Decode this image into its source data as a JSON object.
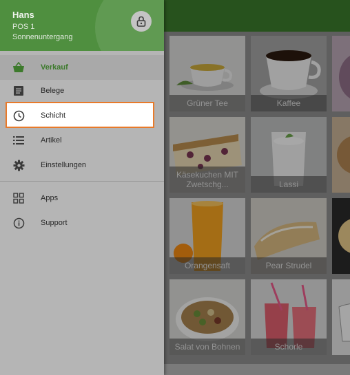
{
  "drawer": {
    "user": "Hans",
    "pos": "POS 1",
    "location": "Sonnenuntergang",
    "items": [
      {
        "label": "Verkauf"
      },
      {
        "label": "Belege"
      },
      {
        "label": "Schicht"
      },
      {
        "label": "Artikel"
      },
      {
        "label": "Einstellungen"
      },
      {
        "label": "Apps"
      },
      {
        "label": "Support"
      }
    ]
  },
  "products": [
    {
      "label": "Grüner Tee"
    },
    {
      "label": "Kaffee"
    },
    {
      "label": "Käsekuchen MIT Zwetschg..."
    },
    {
      "label": "Lassi"
    },
    {
      "label": "Orangensaft"
    },
    {
      "label": "Pear Strudel"
    },
    {
      "label": "Salat von Bohnen"
    },
    {
      "label": "Schorle"
    }
  ],
  "colors": {
    "brand_green": "#4f8f3f",
    "active_text": "#3d7a2c",
    "highlight_border": "#e87a2a"
  }
}
